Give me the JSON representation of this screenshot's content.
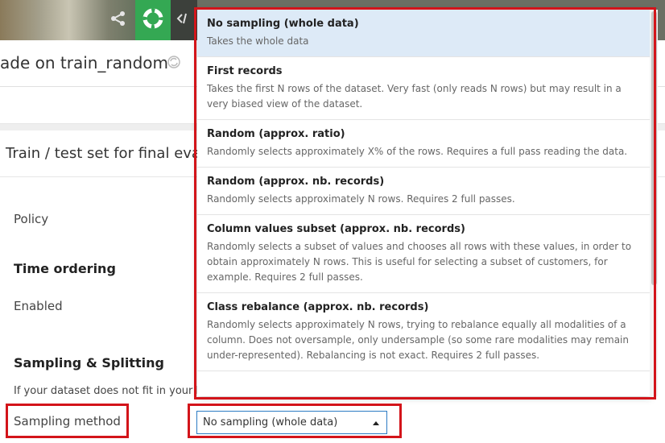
{
  "header": {
    "title": "ade on train_random"
  },
  "section": {
    "title": "Train / test set for final evalu"
  },
  "form": {
    "policy_label": "Policy",
    "time_ordering_heading": "Time ordering",
    "enabled_label": "Enabled",
    "sampling_heading": "Sampling & Splitting",
    "ram_note": "If your dataset does not fit in your RA",
    "sampling_method_label": "Sampling method",
    "sampling_method_value": "No sampling (whole data)"
  },
  "dropdown": {
    "options": [
      {
        "name": "No sampling (whole data)",
        "description": "Takes the whole data",
        "selected": true
      },
      {
        "name": "First records",
        "description": "Takes the first N rows of the dataset. Very fast (only reads N rows) but may result in a very biased view of the dataset.",
        "selected": false
      },
      {
        "name": "Random (approx. ratio)",
        "description": "Randomly selects approximately X% of the rows. Requires a full pass reading the data.",
        "selected": false
      },
      {
        "name": "Random (approx. nb. records)",
        "description": "Randomly selects approximately N rows. Requires 2 full passes.",
        "selected": false
      },
      {
        "name": "Column values subset (approx. nb. records)",
        "description": "Randomly selects a subset of values and chooses all rows with these values, in order to obtain approximately N rows. This is useful for selecting a subset of customers, for example. Requires 2 full passes.",
        "selected": false
      },
      {
        "name": "Class rebalance (approx. nb. records)",
        "description": "Randomly selects approximately N rows, trying to rebalance equally all modalities of a column. Does not oversample, only undersample (so some rare modalities may remain under-represented). Rebalancing is not exact. Requires 2 full passes.",
        "selected": false
      }
    ]
  },
  "icons": {
    "share": "share-icon",
    "lifebuoy": "lifebuoy-icon",
    "code": "code-icon",
    "title_status": "sync-icon"
  },
  "colors": {
    "highlight": "#d3141a",
    "selected_bg": "#ddeaf7",
    "lifebuoy_green": "#34a853",
    "select_border": "#2c7bc4"
  }
}
